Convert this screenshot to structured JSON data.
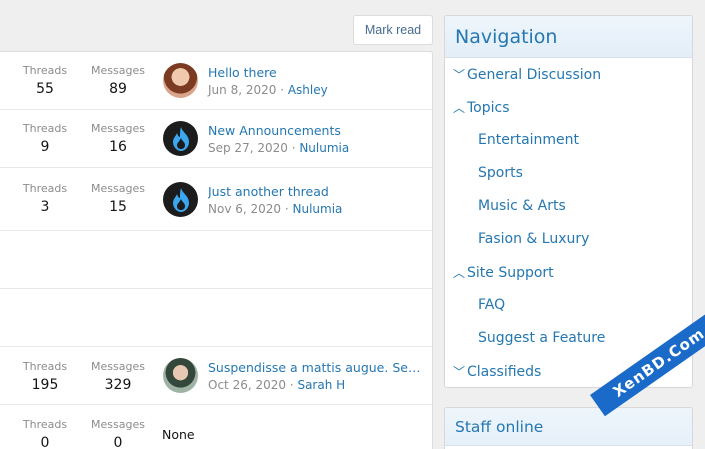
{
  "toolbar": {
    "mark_read": "Mark read"
  },
  "forums": [
    {
      "threads_label": "Threads",
      "threads": "55",
      "messages_label": "Messages",
      "messages": "89",
      "latest_title": "Hello there",
      "latest_date": "Jun 8, 2020",
      "latest_sep": " · ",
      "latest_user": "Ashley",
      "avatar": "ashley-avatar"
    },
    {
      "threads_label": "Threads",
      "threads": "9",
      "messages_label": "Messages",
      "messages": "16",
      "latest_title": "New Announcements",
      "latest_date": "Sep 27, 2020",
      "latest_sep": " · ",
      "latest_user": "Nulumia",
      "avatar": "flame-avatar"
    },
    {
      "threads_label": "Threads",
      "threads": "3",
      "messages_label": "Messages",
      "messages": "15",
      "latest_title": "Just another thread",
      "latest_date": "Nov 6, 2020",
      "latest_sep": " · ",
      "latest_user": "Nulumia",
      "avatar": "flame-avatar"
    },
    {
      "threads_label": "Threads",
      "threads": "195",
      "messages_label": "Messages",
      "messages": "329",
      "latest_title": "Suspendisse a mattis augue. Sed dictum",
      "latest_date": "Oct 26, 2020",
      "latest_sep": " · ",
      "latest_user": "Sarah H",
      "avatar": "sarah-avatar"
    },
    {
      "threads_label": "Threads",
      "threads": "0",
      "messages_label": "Messages",
      "messages": "0",
      "none": "None"
    }
  ],
  "navigation": {
    "title": "Navigation",
    "items": [
      {
        "label": "General Discussion",
        "chevron": "chevron-down-icon"
      },
      {
        "label": "Topics",
        "chevron": "chevron-up-icon"
      },
      {
        "label": "Entertainment"
      },
      {
        "label": "Sports"
      },
      {
        "label": "Music & Arts"
      },
      {
        "label": "Fasion & Luxury"
      },
      {
        "label": "Site Support",
        "chevron": "chevron-up-icon"
      },
      {
        "label": "FAQ"
      },
      {
        "label": "Suggest a Feature"
      },
      {
        "label": "Classifieds",
        "chevron": "chevron-down-icon"
      }
    ]
  },
  "staff": {
    "title": "Staff online"
  },
  "watermark": {
    "text": "XenBD.Com"
  },
  "colors": {
    "link": "#2577b1",
    "muted": "#8c8c8c",
    "watermark": "#1a6ac9"
  }
}
